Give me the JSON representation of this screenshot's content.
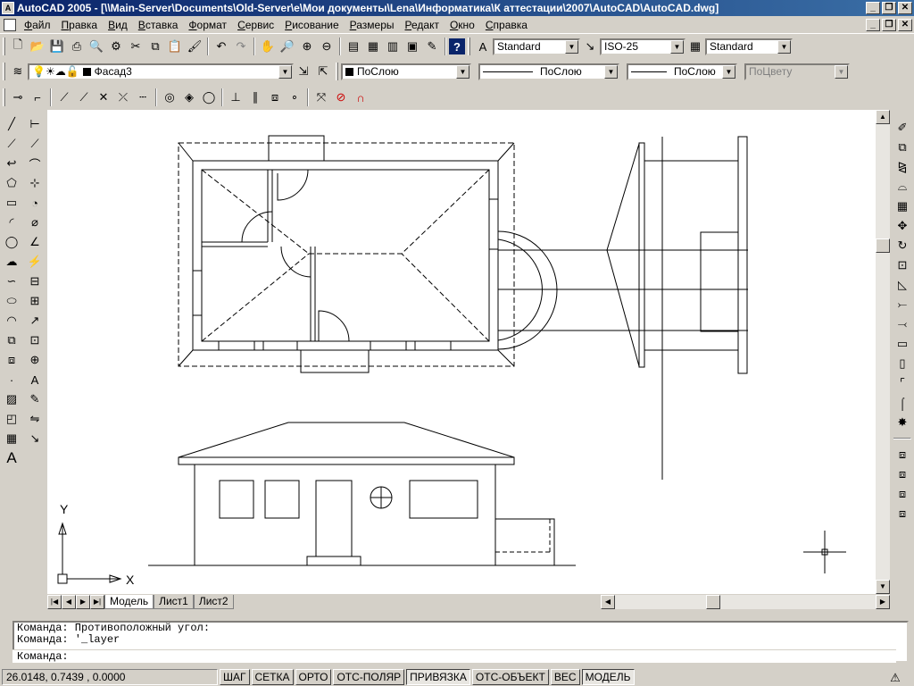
{
  "window": {
    "title": "AutoCAD 2005 - [\\\\Main-Server\\Documents\\Old-Server\\e\\Мои документы\\Lena\\Информатика\\К аттестации\\2007\\AutoCAD\\AutoCAD.dwg]",
    "app_icon": "A",
    "minimize": "_",
    "restore": "❐",
    "close": "✕"
  },
  "menu": [
    "Файл",
    "Правка",
    "Вид",
    "Вставка",
    "Формат",
    "Сервис",
    "Рисование",
    "Размеры",
    "Редакт",
    "Окно",
    "Справка"
  ],
  "styles": {
    "text_style": "Standard",
    "dim_style": "ISO-25",
    "table_style": "Standard"
  },
  "layers": {
    "current_layer": "Фасад3",
    "color": "ПоСлою",
    "linetype": "ПоСлою",
    "lineweight": "ПоСлою",
    "plotstyle": "ПоЦвету"
  },
  "tabs": {
    "items": [
      "Модель",
      "Лист1",
      "Лист2"
    ],
    "active": 0
  },
  "command": {
    "history": [
      "Команда: Противоположный угол:",
      "Команда: '_layer"
    ],
    "prompt": "Команда:"
  },
  "status": {
    "coords": "26.0148, 0.7439 , 0.0000",
    "toggles": [
      "ШАГ",
      "СЕТКА",
      "ОРТО",
      "ОТС-ПОЛЯР",
      "ПРИВЯЗКА",
      "ОТС-ОБЪЕКТ",
      "ВЕС",
      "МОДЕЛЬ"
    ],
    "active_toggles": [
      "ПРИВЯЗКА",
      "МОДЕЛЬ"
    ]
  },
  "ucs": {
    "x_label": "X",
    "y_label": "Y"
  },
  "icons": {
    "standard_toolbar": [
      "new-icon",
      "open-icon",
      "save-icon",
      "print-icon",
      "preview-icon",
      "publish-icon",
      "cut-icon",
      "copy-icon",
      "paste-icon",
      "matchprop-icon",
      "undo-icon",
      "redo-icon",
      "pan-icon",
      "zoom-realtime-icon",
      "zoom-window-icon",
      "zoom-previous-icon",
      "properties-icon",
      "designcenter-icon",
      "toolpalettes-icon",
      "sheetset-icon",
      "markup-icon",
      "help-icon"
    ],
    "draw_toolbar": [
      "line-icon",
      "xline-icon",
      "pline-icon",
      "polygon-icon",
      "rectangle-icon",
      "arc-icon",
      "circle-icon",
      "revcloud-icon",
      "spline-icon",
      "ellipse-icon",
      "ellipse-arc-icon",
      "insert-block-icon",
      "make-block-icon",
      "point-icon",
      "hatch-icon",
      "region-icon",
      "table-icon",
      "mtext-icon"
    ],
    "modify_toolbar": [
      "erase-icon",
      "copy-object-icon",
      "mirror-icon",
      "offset-icon",
      "array-icon",
      "move-icon",
      "rotate-icon",
      "scale-icon",
      "stretch-icon",
      "trim-icon",
      "extend-icon",
      "break-point-icon",
      "break-icon",
      "chamfer-icon",
      "fillet-icon",
      "explode-icon"
    ]
  }
}
